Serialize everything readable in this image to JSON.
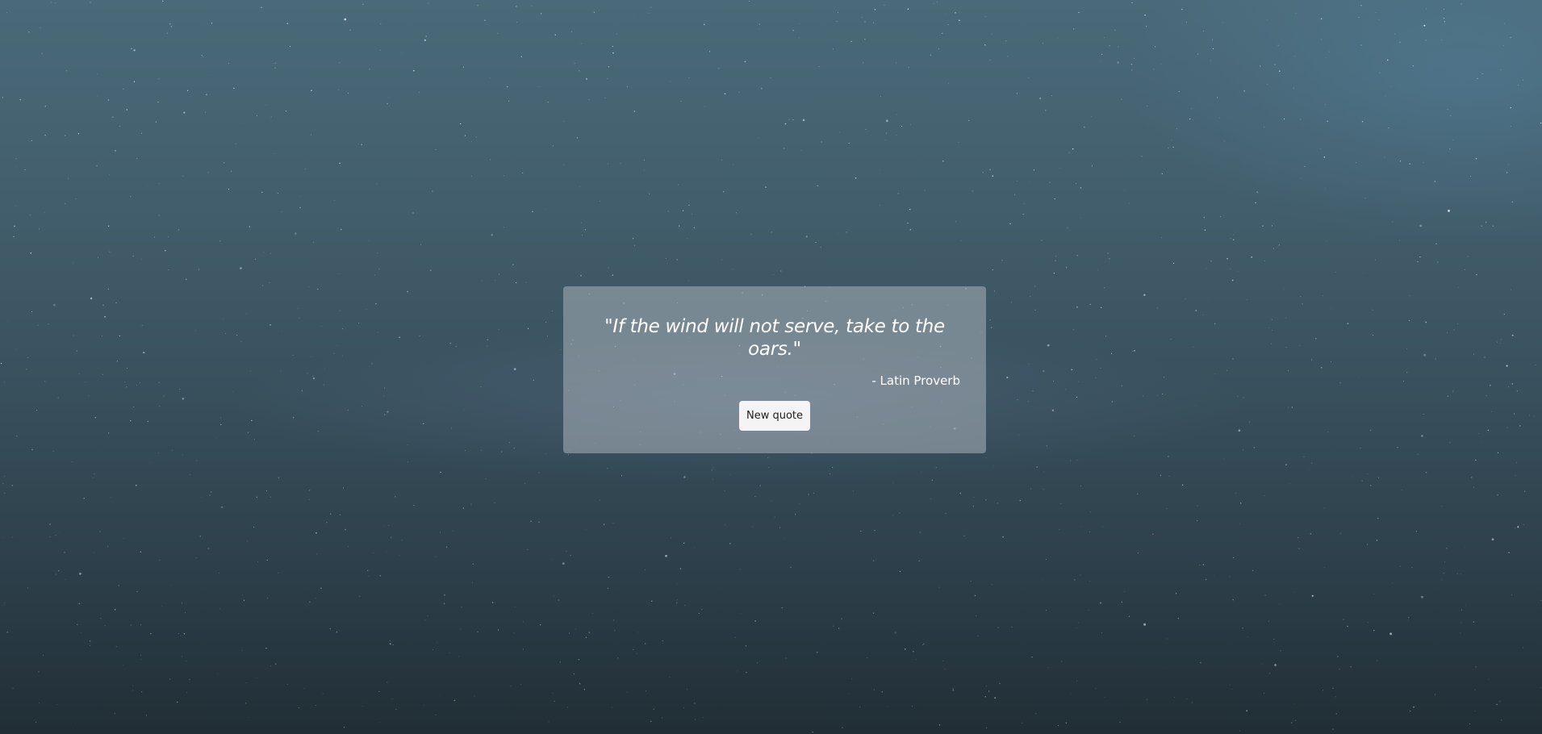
{
  "quote": {
    "text": "\"If the wind will not serve, take to the oars.\"",
    "author": "- Latin Proverb"
  },
  "actions": {
    "new_quote_label": "New quote"
  },
  "colors": {
    "sky_top": "#4a6a79",
    "sky_bottom": "#212e36",
    "card_background": "rgba(170,178,186,0.55)",
    "button_background": "#f4f4f4"
  }
}
